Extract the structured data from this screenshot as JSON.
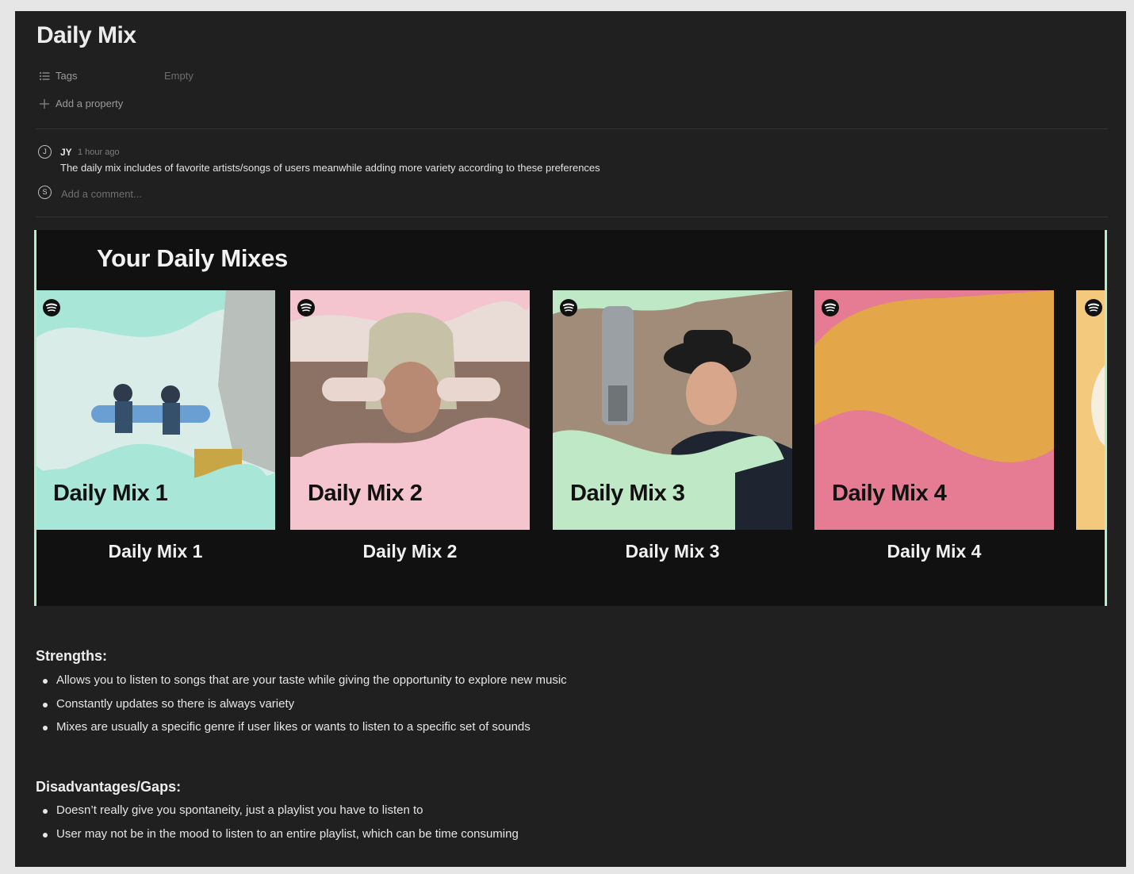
{
  "page": {
    "title": "Daily Mix",
    "properties": {
      "tags_label": "Tags",
      "tags_value": "Empty",
      "add_property_label": "Add a property"
    },
    "comment": {
      "avatar_initial": "J",
      "author": "JY",
      "time": "1 hour ago",
      "text": "The daily mix includes of favorite artists/songs of users meanwhile adding more variety according to these preferences"
    },
    "add_comment": {
      "avatar_initial": "S",
      "placeholder": "Add a comment..."
    }
  },
  "embed": {
    "heading": "Your Daily Mixes",
    "cards": [
      {
        "cover_label": "Daily Mix 1",
        "caption": "Daily Mix 1",
        "accent": "#a8e6d8"
      },
      {
        "cover_label": "Daily Mix 2",
        "caption": "Daily Mix 2",
        "accent": "#f4c5cf"
      },
      {
        "cover_label": "Daily Mix 3",
        "caption": "Daily Mix 3",
        "accent": "#bfe8c7"
      },
      {
        "cover_label": "Daily Mix 4",
        "caption": "Daily Mix 4",
        "accent": "#e57c93"
      }
    ]
  },
  "strengths": {
    "heading": "Strengths:",
    "items": [
      "Allows you to listen to songs that are your taste while giving the opportunity to explore new music",
      "Constantly updates so there is always variety",
      "Mixes are usually a specific genre if user likes or wants to listen to a specific set of sounds"
    ]
  },
  "gaps": {
    "heading": "Disadvantages/Gaps:",
    "items": [
      "Doesn’t really give you spontaneity, just a playlist you have to listen to",
      "User may not be in the mood to listen to an entire playlist, which can be time consuming"
    ]
  }
}
